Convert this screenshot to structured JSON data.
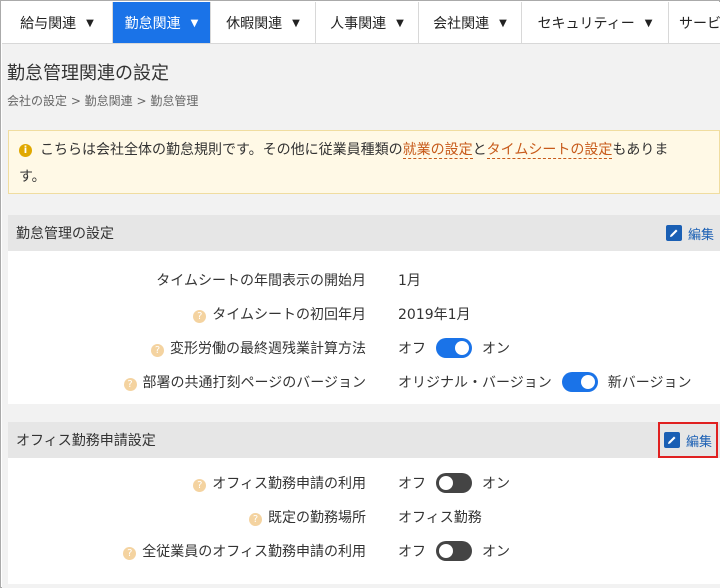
{
  "nav": {
    "items": [
      {
        "label": "給与関連"
      },
      {
        "label": "勤怠関連"
      },
      {
        "label": "休暇関連"
      },
      {
        "label": "人事関連"
      },
      {
        "label": "会社関連"
      },
      {
        "label": "セキュリティー"
      },
      {
        "label": "サービ"
      }
    ],
    "active_index": 1
  },
  "page": {
    "title": "勤怠管理関連の設定",
    "breadcrumb": "会社の設定 > 勤怠関連 > 勤怠管理"
  },
  "notice": {
    "text_before": "こちらは会社全体の勤怠規則です。その他に従業員種類の",
    "link1": "就業の設定",
    "text_mid": "と",
    "link2": "タイムシートの設定",
    "text_after": "もありま",
    "text_wrap": "す。"
  },
  "section1": {
    "title": "勤怠管理の設定",
    "edit_label": "編集",
    "rows": [
      {
        "label": "タイムシートの年間表示の開始月",
        "value": "1月"
      },
      {
        "label": "タイムシートの初回年月",
        "value": "2019年1月"
      },
      {
        "label": "変形労働の最終週残業計算方法",
        "off": "オフ",
        "on": "オン",
        "state": "on"
      },
      {
        "label": "部署の共通打刻ページのバージョン",
        "off": "オリジナル・バージョン",
        "on": "新バージョン",
        "state": "on"
      }
    ]
  },
  "section2": {
    "title": "オフィス勤務申請設定",
    "edit_label": "編集",
    "rows": [
      {
        "label": "オフィス勤務申請の利用",
        "off": "オフ",
        "on": "オン",
        "state": "off"
      },
      {
        "label": "既定の勤務場所",
        "value": "オフィス勤務"
      },
      {
        "label": "全従業員のオフィス勤務申請の利用",
        "off": "オフ",
        "on": "オン",
        "state": "off"
      }
    ]
  },
  "colors": {
    "accent": "#1a73e8",
    "highlight_border": "#e02020",
    "link": "#c75a1a"
  }
}
